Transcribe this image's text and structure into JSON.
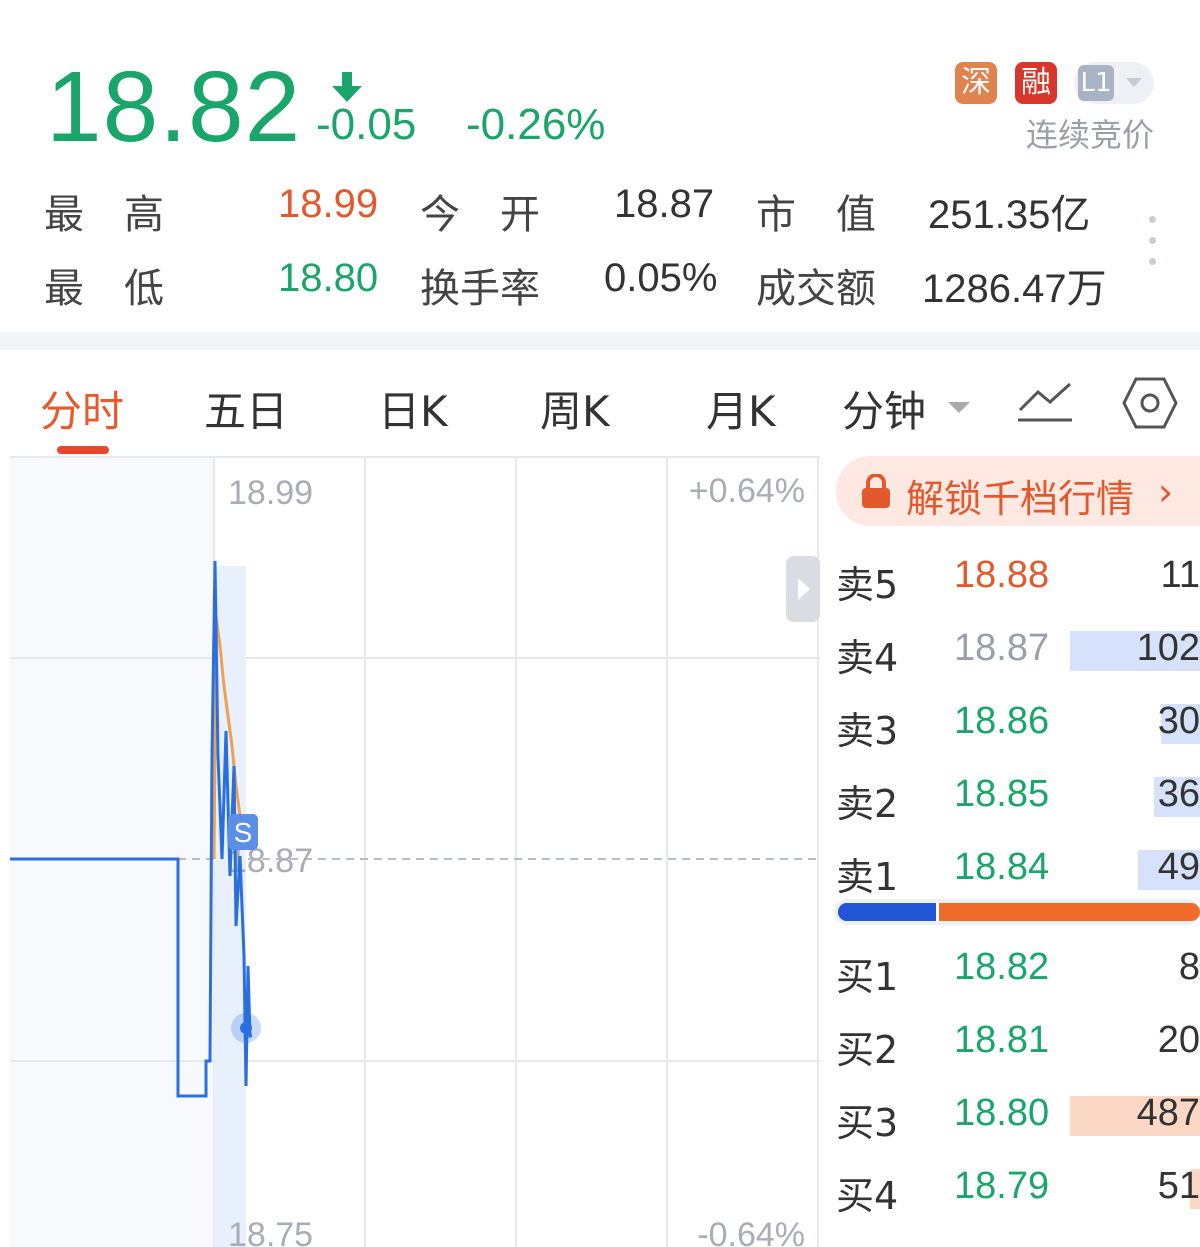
{
  "header": {
    "price": "18.82",
    "change": "-0.05",
    "change_pct": "-0.26%",
    "badges": [
      "深",
      "融",
      "L1"
    ],
    "auction_status": "连续竞价"
  },
  "stats": {
    "high": {
      "label": "最　高",
      "value": "18.99"
    },
    "open": {
      "label": "今　开",
      "value": "18.87"
    },
    "market_cap": {
      "label": "市　值",
      "value": "251.35亿"
    },
    "low": {
      "label": "最　低",
      "value": "18.80"
    },
    "turnover": {
      "label": "换手率",
      "value": "0.05%"
    },
    "amount": {
      "label": "成交额",
      "value": "1286.47万"
    }
  },
  "tabs": [
    "分时",
    "五日",
    "日K",
    "周K",
    "月K",
    "分钟"
  ],
  "chart": {
    "price_top": "18.99",
    "price_mid": "18.87",
    "price_bottom": "18.75",
    "pct_top": "+0.64%",
    "pct_bottom": "-0.64%",
    "marker": "S"
  },
  "orderbook": {
    "unlock_label": "解锁千档行情",
    "sell": [
      {
        "label": "卖5",
        "price": "18.88",
        "volume": "11",
        "bar": 0.0
      },
      {
        "label": "卖4",
        "price": "18.87",
        "volume": "102",
        "bar": 1.0
      },
      {
        "label": "卖3",
        "price": "18.86",
        "volume": "30",
        "bar": 0.3
      },
      {
        "label": "卖2",
        "price": "18.85",
        "volume": "36",
        "bar": 0.35
      },
      {
        "label": "卖1",
        "price": "18.84",
        "volume": "49",
        "bar": 0.48
      }
    ],
    "buy_ratio": 0.27,
    "buy": [
      {
        "label": "买1",
        "price": "18.82",
        "volume": "8",
        "bar": 0.0
      },
      {
        "label": "买2",
        "price": "18.81",
        "volume": "20",
        "bar": 0.0
      },
      {
        "label": "买3",
        "price": "18.80",
        "volume": "487",
        "bar": 1.0
      },
      {
        "label": "买4",
        "price": "18.79",
        "volume": "51",
        "bar": 0.08
      }
    ]
  },
  "colors": {
    "down": "#1aa56b",
    "up": "#e4582e",
    "neutral": "#9aa0aa",
    "price_line": "#2a6fe0",
    "avg_line": "#f0a050",
    "sell_bar": "#d6e2fb",
    "buy_bar": "#fbd8c6"
  }
}
